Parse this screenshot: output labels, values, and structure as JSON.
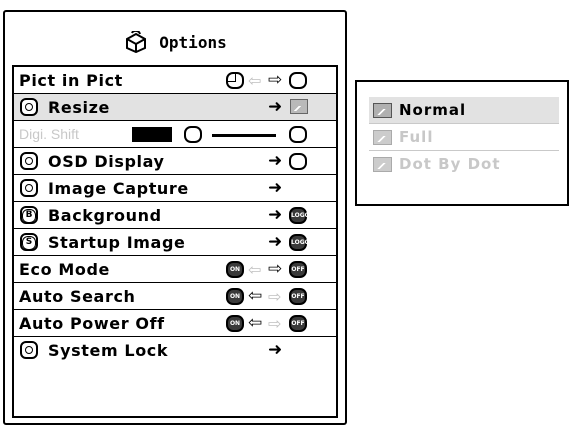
{
  "panel": {
    "title": "Options",
    "title_icon": "options-icon"
  },
  "menu": [
    {
      "label": "Pict in Pict",
      "control": "toggle-pip"
    },
    {
      "label": "Resize",
      "icon": "resize-icon",
      "selected": true
    },
    {
      "label": "Digi. Shift",
      "disabled": true
    },
    {
      "label": "OSD Display",
      "icon": "osd-icon"
    },
    {
      "label": "Image Capture",
      "icon": "capture-icon"
    },
    {
      "label": "Background",
      "icon": "background-icon",
      "icon_letter": "B"
    },
    {
      "label": "Startup Image",
      "icon": "startup-icon",
      "icon_letter": "S"
    },
    {
      "label": "Eco Mode",
      "value": "OFF"
    },
    {
      "label": "Auto Search",
      "value": "ON"
    },
    {
      "label": "Auto Power Off",
      "value": "ON"
    },
    {
      "label": "System Lock",
      "icon": "lock-icon"
    }
  ],
  "badges": {
    "on": "ON",
    "off": "OFF",
    "logo": "LOGO"
  },
  "submenu": {
    "items": [
      {
        "label": "Normal",
        "active": true,
        "disabled": false
      },
      {
        "label": "Full",
        "active": false,
        "disabled": true
      },
      {
        "label": "Dot By Dot",
        "active": false,
        "disabled": true
      }
    ]
  },
  "colors": {
    "selected_bg": "#e2e2e2",
    "disabled_text": "#c8c8c8"
  }
}
